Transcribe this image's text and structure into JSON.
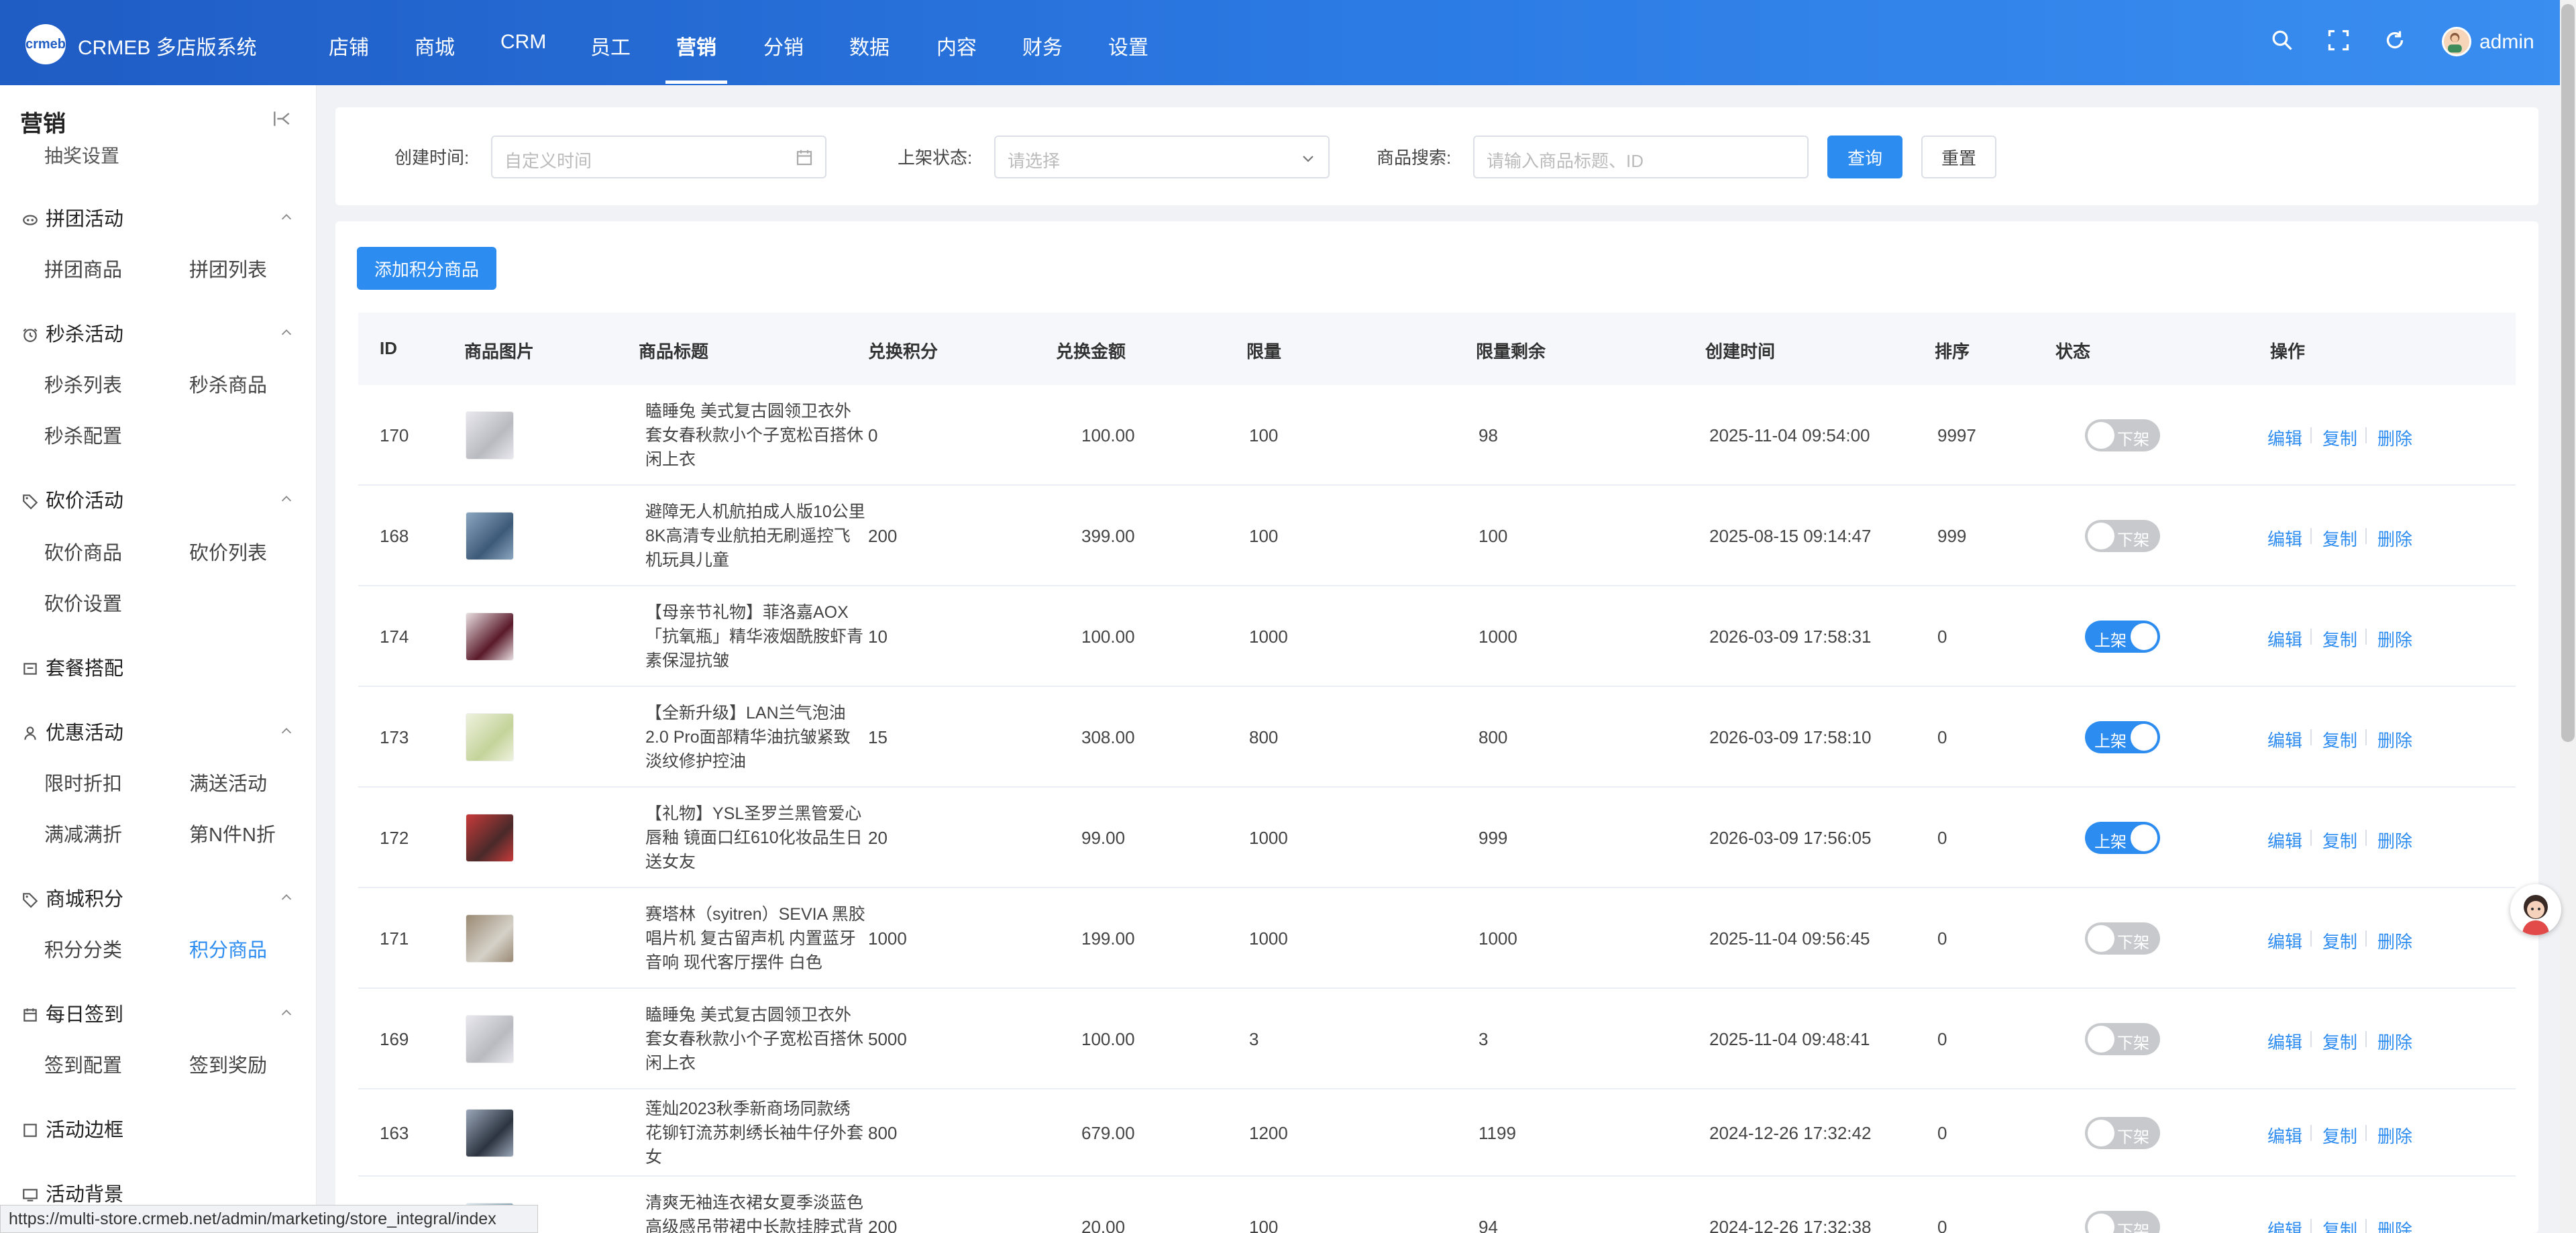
{
  "app": {
    "brand": "CRMEB 多店版系统",
    "logo_text": "crmeb"
  },
  "nav": {
    "items": [
      "店铺",
      "商城",
      "CRM",
      "员工",
      "营销",
      "分销",
      "数据",
      "内容",
      "财务",
      "设置"
    ],
    "active": "营销"
  },
  "user": {
    "name": "admin"
  },
  "sidebar": {
    "title": "营销",
    "top_item": "抽奖设置",
    "groups": [
      {
        "label": "拼团活动",
        "icon": "group-buy-icon",
        "items": [
          "拼团商品",
          "拼团列表"
        ]
      },
      {
        "label": "秒杀活动",
        "icon": "clock-icon",
        "items": [
          "秒杀列表",
          "秒杀商品",
          "秒杀配置"
        ]
      },
      {
        "label": "砍价活动",
        "icon": "tag-icon",
        "items": [
          "砍价商品",
          "砍价列表",
          "砍价设置"
        ]
      },
      {
        "label": "套餐搭配",
        "icon": "package-icon",
        "items": []
      },
      {
        "label": "优惠活动",
        "icon": "user-icon",
        "items": [
          "限时折扣",
          "满送活动",
          "满减满折",
          "第N件N折"
        ]
      },
      {
        "label": "商城积分",
        "icon": "tag-icon",
        "items": [
          "积分分类",
          "积分商品"
        ]
      },
      {
        "label": "每日签到",
        "icon": "calendar-icon",
        "items": [
          "签到配置",
          "签到奖励"
        ]
      },
      {
        "label": "活动边框",
        "icon": "square-icon",
        "items": []
      },
      {
        "label": "活动背景",
        "icon": "monitor-icon",
        "items": []
      }
    ],
    "active_item": "积分商品"
  },
  "filter": {
    "date_label": "创建时间:",
    "date_placeholder": "自定义时间",
    "status_label": "上架状态:",
    "status_placeholder": "请选择",
    "search_label": "商品搜索:",
    "search_placeholder": "请输入商品标题、ID",
    "query_button": "查询",
    "reset_button": "重置"
  },
  "add_button": "添加积分商品",
  "table": {
    "columns": [
      "ID",
      "商品图片",
      "商品标题",
      "兑换积分",
      "兑换金额",
      "限量",
      "限量剩余",
      "创建时间",
      "排序",
      "状态",
      "操作"
    ],
    "actions": [
      "编辑",
      "复制",
      "删除"
    ],
    "status_labels": {
      "on": "上架",
      "off": "下架"
    },
    "rows": [
      {
        "id": "170",
        "title": "瞌睡兔 美式复古圆领卫衣外套女春秋款小个子宽松百搭休闲上衣",
        "points": "0",
        "amount": "100.00",
        "limit": "100",
        "remaining": "98",
        "created": "2025-11-04 09:54:00",
        "sort": "9997",
        "status": "off"
      },
      {
        "id": "168",
        "title": "避障无人机航拍成人版10公里8K高清专业航拍无刷遥控飞机玩具儿童",
        "points": "200",
        "amount": "399.00",
        "limit": "100",
        "remaining": "100",
        "created": "2025-08-15 09:14:47",
        "sort": "999",
        "status": "off"
      },
      {
        "id": "174",
        "title": "【母亲节礼物】菲洛嘉AOX「抗氧瓶」精华液烟酰胺虾青素保湿抗皱",
        "points": "10",
        "amount": "100.00",
        "limit": "1000",
        "remaining": "1000",
        "created": "2026-03-09 17:58:31",
        "sort": "0",
        "status": "on"
      },
      {
        "id": "173",
        "title": "【全新升级】LAN兰气泡油2.0 Pro面部精华油抗皱紧致淡纹修护控油",
        "points": "15",
        "amount": "308.00",
        "limit": "800",
        "remaining": "800",
        "created": "2026-03-09 17:58:10",
        "sort": "0",
        "status": "on"
      },
      {
        "id": "172",
        "title": "【礼物】YSL圣罗兰黑管爱心唇釉 镜面口红610化妆品生日送女友",
        "points": "20",
        "amount": "99.00",
        "limit": "1000",
        "remaining": "999",
        "created": "2026-03-09 17:56:05",
        "sort": "0",
        "status": "on"
      },
      {
        "id": "171",
        "title": "赛塔林（syitren）SEVIA 黑胶唱片机 复古留声机 内置蓝牙音响 现代客厅摆件 白色",
        "points": "1000",
        "amount": "199.00",
        "limit": "1000",
        "remaining": "1000",
        "created": "2025-11-04 09:56:45",
        "sort": "0",
        "status": "off"
      },
      {
        "id": "169",
        "title": "瞌睡兔 美式复古圆领卫衣外套女春秋款小个子宽松百搭休闲上衣",
        "points": "5000",
        "amount": "100.00",
        "limit": "3",
        "remaining": "3",
        "created": "2025-11-04 09:48:41",
        "sort": "0",
        "status": "off"
      },
      {
        "id": "163",
        "title": "莲灿2023秋季新商场同款绣花铆钉流苏刺绣长袖牛仔外套女",
        "points": "800",
        "amount": "679.00",
        "limit": "1200",
        "remaining": "1199",
        "created": "2024-12-26 17:32:42",
        "sort": "0",
        "status": "off"
      },
      {
        "id": "",
        "title": "清爽无袖连衣裙女夏季淡蓝色高级感吊带裙中长款挂脖式背",
        "points": "200",
        "amount": "20.00",
        "limit": "100",
        "remaining": "94",
        "created": "2024-12-26 17:32:38",
        "sort": "0",
        "status": "off"
      }
    ]
  },
  "status_url": "https://multi-store.crmeb.net/admin/marketing/store_integral/index",
  "colors": {
    "primary": "#2d8cf0",
    "header_start": "#1f5cc4",
    "header_end": "#3a8ef0"
  }
}
